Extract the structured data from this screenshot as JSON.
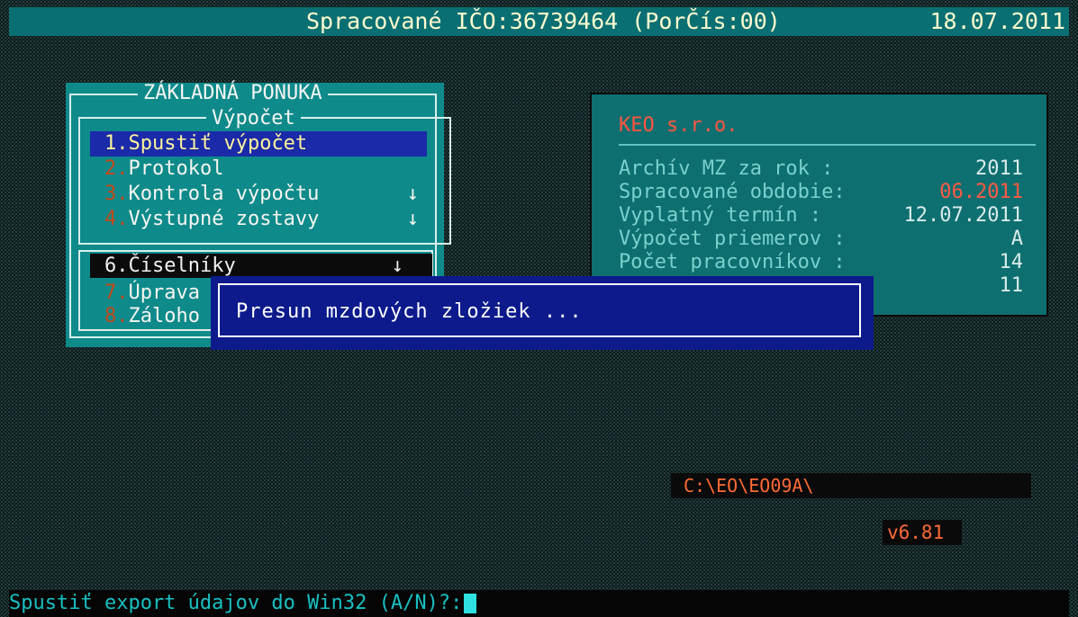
{
  "header": {
    "title": "Spracované IČO:36739464 (PorČís:00)",
    "date": "18.07.2011"
  },
  "main_menu": {
    "title": "ZÁKLADNÁ PONUKA",
    "sub_title": "Výpočet",
    "items": [
      {
        "num": "1.",
        "label": "Spustiť výpočet",
        "arrow": ""
      },
      {
        "num": "2.",
        "label": "Protokol",
        "arrow": ""
      },
      {
        "num": "3.",
        "label": "Kontrola výpočtu",
        "arrow": "↓"
      },
      {
        "num": "4.",
        "label": "Výstupné zostavy",
        "arrow": "↓"
      },
      {
        "num": "6.",
        "label": "Číselníky",
        "arrow": "↓"
      },
      {
        "num": "7.",
        "label": "Úprava",
        "arrow": ""
      },
      {
        "num": "8.",
        "label": "Záloho",
        "arrow": ""
      }
    ]
  },
  "info": {
    "company": "KEO s.r.o.",
    "rows": [
      {
        "label": "Archív MZ za rok  :",
        "value": "2011"
      },
      {
        "label": "Spracované obdobie:",
        "value": "06.2011"
      },
      {
        "label": "Vyplatný termín   :",
        "value": "12.07.2011"
      },
      {
        "label": "Výpočet priemerov :",
        "value": "A"
      },
      {
        "label": "Počet pracovníkov :",
        "value": "14"
      },
      {
        "label": "",
        "value": "11"
      }
    ]
  },
  "modal": {
    "message": "Presun mzdových zložiek ..."
  },
  "path": "C:\\EO\\EO09A\\",
  "version": "v6.81",
  "prompt": {
    "text": "Spustiť export údajov do Win32 (A/N)?:"
  },
  "colors": {
    "accent_teal": "#0e8a8b",
    "highlight_blue": "#1a2aa8",
    "red_value": "#ff5a46"
  }
}
